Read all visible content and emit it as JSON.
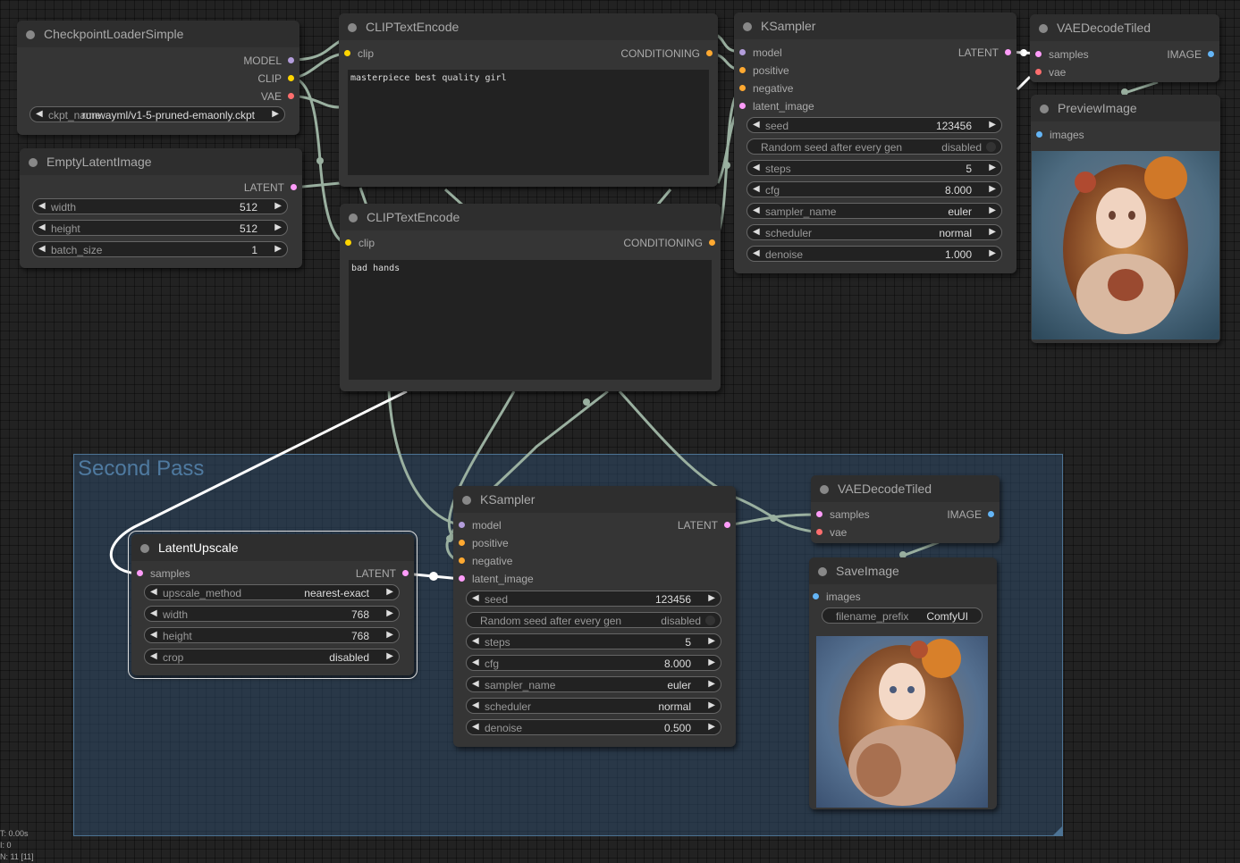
{
  "colors": {
    "model": "#b39ddb",
    "clip": "#ffd500",
    "vae": "#ff6e6e",
    "conditioning": "#ffa931",
    "latent": "#ff9cf9",
    "image": "#64b5f6",
    "wire": "#9ab0a0",
    "selected_wire": "#ffffff"
  },
  "group": {
    "title": "Second Pass"
  },
  "nodes": {
    "checkpoint": {
      "title": "CheckpointLoaderSimple",
      "outputs": [
        "MODEL",
        "CLIP",
        "VAE"
      ],
      "ckpt_label": "ckpt_name",
      "ckpt_value": "runwayml/v1-5-pruned-emaonly.ckpt"
    },
    "empty_latent": {
      "title": "EmptyLatentImage",
      "output": "LATENT",
      "widgets": [
        {
          "label": "width",
          "value": "512"
        },
        {
          "label": "height",
          "value": "512"
        },
        {
          "label": "batch_size",
          "value": "1"
        }
      ]
    },
    "clip_pos": {
      "title": "CLIPTextEncode",
      "input": "clip",
      "output": "CONDITIONING",
      "text": "masterpiece best quality girl"
    },
    "clip_neg": {
      "title": "CLIPTextEncode",
      "input": "clip",
      "output": "CONDITIONING",
      "text": "bad hands"
    },
    "ksampler1": {
      "title": "KSampler",
      "inputs": [
        "model",
        "positive",
        "negative",
        "latent_image"
      ],
      "output": "LATENT",
      "widgets": [
        {
          "label": "seed",
          "value": "123456"
        },
        {
          "label": "Random seed after every gen",
          "value": "disabled"
        },
        {
          "label": "steps",
          "value": "5"
        },
        {
          "label": "cfg",
          "value": "8.000"
        },
        {
          "label": "sampler_name",
          "value": "euler"
        },
        {
          "label": "scheduler",
          "value": "normal"
        },
        {
          "label": "denoise",
          "value": "1.000"
        }
      ]
    },
    "vae_decode1": {
      "title": "VAEDecodeTiled",
      "inputs": [
        "samples",
        "vae"
      ],
      "output": "IMAGE"
    },
    "preview": {
      "title": "PreviewImage",
      "input": "images"
    },
    "latent_upscale": {
      "title": "LatentUpscale",
      "input": "samples",
      "output": "LATENT",
      "widgets": [
        {
          "label": "upscale_method",
          "value": "nearest-exact"
        },
        {
          "label": "width",
          "value": "768"
        },
        {
          "label": "height",
          "value": "768"
        },
        {
          "label": "crop",
          "value": "disabled"
        }
      ]
    },
    "ksampler2": {
      "title": "KSampler",
      "inputs": [
        "model",
        "positive",
        "negative",
        "latent_image"
      ],
      "output": "LATENT",
      "widgets": [
        {
          "label": "seed",
          "value": "123456"
        },
        {
          "label": "Random seed after every gen",
          "value": "disabled"
        },
        {
          "label": "steps",
          "value": "5"
        },
        {
          "label": "cfg",
          "value": "8.000"
        },
        {
          "label": "sampler_name",
          "value": "euler"
        },
        {
          "label": "scheduler",
          "value": "normal"
        },
        {
          "label": "denoise",
          "value": "0.500"
        }
      ]
    },
    "vae_decode2": {
      "title": "VAEDecodeTiled",
      "inputs": [
        "samples",
        "vae"
      ],
      "output": "IMAGE"
    },
    "save": {
      "title": "SaveImage",
      "input": "images",
      "prefix_label": "filename_prefix",
      "prefix_value": "ComfyUI"
    }
  },
  "stats": {
    "line1": "T: 0.00s",
    "line2": "I: 0",
    "line3": "N: 11 [11]"
  }
}
